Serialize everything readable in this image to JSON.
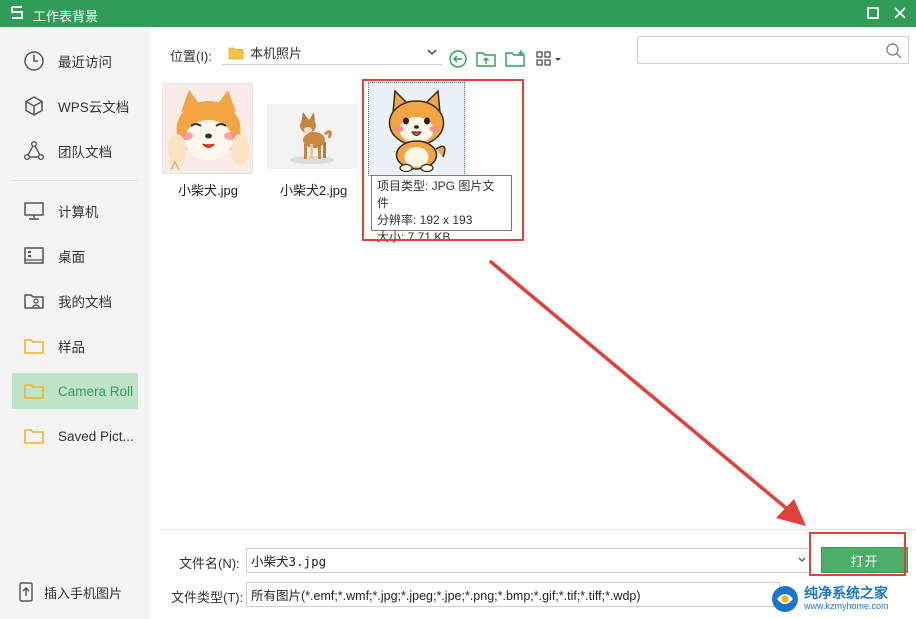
{
  "window": {
    "title": "工作表背景"
  },
  "sidebar": {
    "items": [
      {
        "label": "最近访问",
        "icon": "clock-icon"
      },
      {
        "label": "WPS云文档",
        "icon": "cube-icon"
      },
      {
        "label": "团队文档",
        "icon": "team-icon"
      },
      {
        "label": "计算机",
        "icon": "monitor-icon"
      },
      {
        "label": "桌面",
        "icon": "desktop-icon"
      },
      {
        "label": "我的文档",
        "icon": "user-folder-icon"
      },
      {
        "label": "样品",
        "icon": "folder-icon"
      },
      {
        "label": "Camera Roll",
        "icon": "folder-icon",
        "active": true
      },
      {
        "label": "Saved Pict...",
        "icon": "folder-icon"
      }
    ],
    "phone_button": "插入手机图片"
  },
  "toolbar": {
    "location_label": "位置(I):",
    "location_value": "本机照片",
    "search_placeholder": ""
  },
  "files": [
    {
      "name": "小柴犬.jpg"
    },
    {
      "name": "小柴犬2.jpg"
    },
    {
      "name": "小柴犬3.jpg",
      "selected": true
    }
  ],
  "tooltip": {
    "line1": "项目类型: JPG 图片文件",
    "line2": "分辨率: 192 x 193",
    "line3": "大小: 7.71 KB"
  },
  "bottom": {
    "filename_label": "文件名(N):",
    "filename_value": "小柴犬3.jpg",
    "filetype_label": "文件类型(T):",
    "filetype_value": "所有图片(*.emf;*.wmf;*.jpg;*.jpeg;*.jpe;*.png;*.bmp;*.gif;*.tif;*.tiff;*.wdp)",
    "open_button": "打开"
  },
  "watermark": {
    "title": "纯净系统之家",
    "url": "www.kzmyhome.com"
  },
  "colors": {
    "accent": "#2f9d58",
    "highlight": "#e1403b",
    "active_bg": "#bfe3c6"
  }
}
